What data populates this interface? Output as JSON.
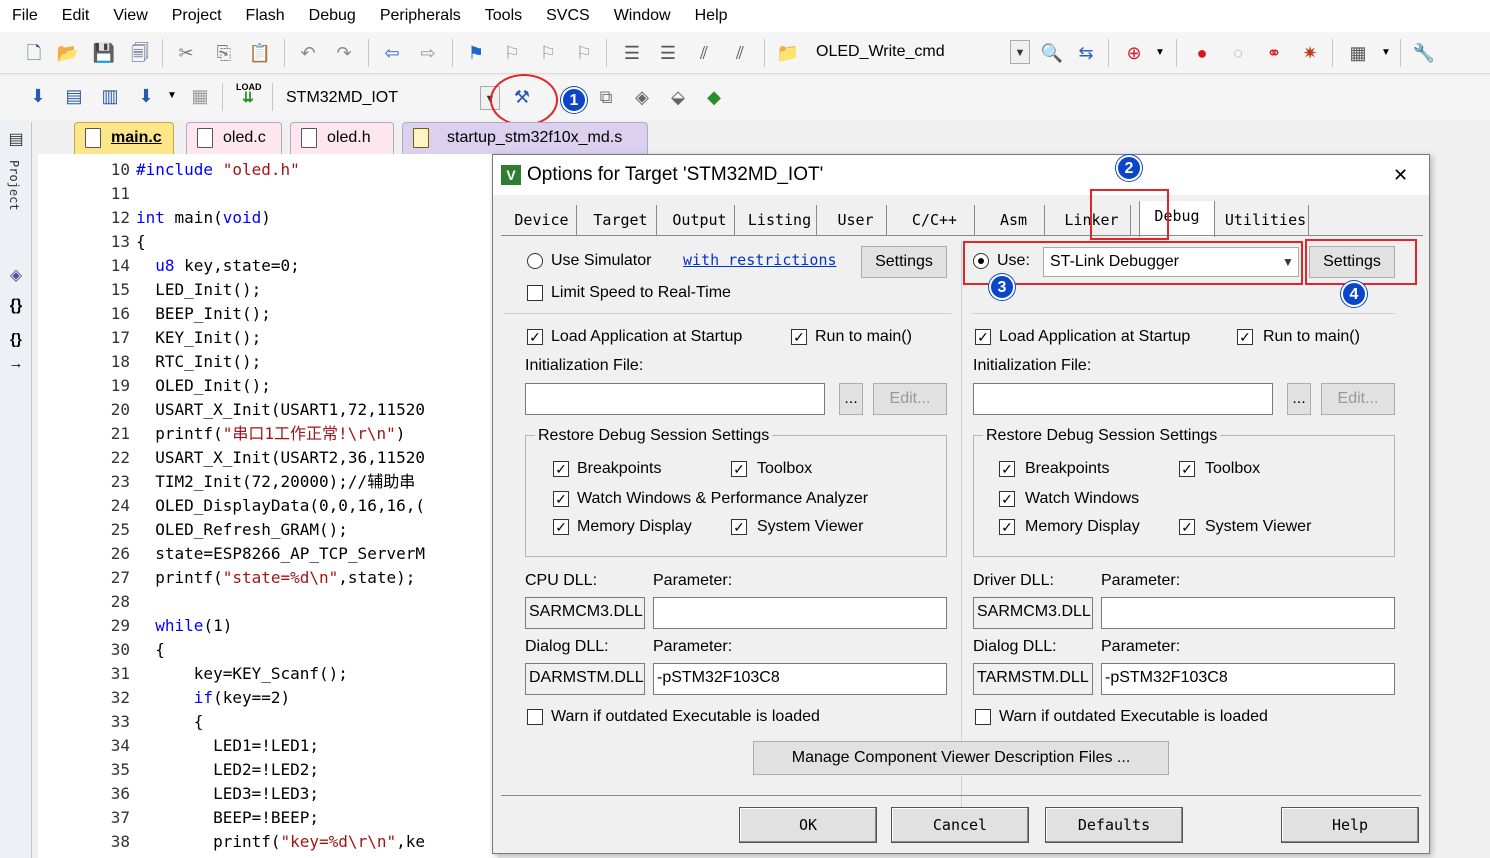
{
  "menubar": {
    "items": [
      "File",
      "Edit",
      "View",
      "Project",
      "Flash",
      "Debug",
      "Peripherals",
      "Tools",
      "SVCS",
      "Window",
      "Help"
    ]
  },
  "toolbar1": {
    "target_combo": "OLED_Write_cmd"
  },
  "toolbar2": {
    "target_select": "STM32MD_IOT",
    "load_label": "LOAD"
  },
  "file_tabs": [
    "main.c",
    "oled.c",
    "oled.h",
    "startup_stm32f10x_md.s"
  ],
  "side_panel": {
    "label": "Project"
  },
  "editor": {
    "lines": [
      {
        "n": "10",
        "t": "#include \"oled.h\""
      },
      {
        "n": "11",
        "t": ""
      },
      {
        "n": "12",
        "t": "int main(void)"
      },
      {
        "n": "13",
        "t": "{"
      },
      {
        "n": "14",
        "t": "  u8 key,state=0;"
      },
      {
        "n": "15",
        "t": "  LED_Init();"
      },
      {
        "n": "16",
        "t": "  BEEP_Init();"
      },
      {
        "n": "17",
        "t": "  KEY_Init();"
      },
      {
        "n": "18",
        "t": "  RTC_Init();"
      },
      {
        "n": "19",
        "t": "  OLED_Init();"
      },
      {
        "n": "20",
        "t": "  USART_X_Init(USART1,72,11520"
      },
      {
        "n": "21",
        "t": "  printf(\"串口1工作正常!\\r\\n\")"
      },
      {
        "n": "22",
        "t": "  USART_X_Init(USART2,36,11520"
      },
      {
        "n": "23",
        "t": "  TIM2_Init(72,20000);//辅助串"
      },
      {
        "n": "24",
        "t": "  OLED_DisplayData(0,0,16,16,("
      },
      {
        "n": "25",
        "t": "  OLED_Refresh_GRAM();"
      },
      {
        "n": "26",
        "t": "  state=ESP8266_AP_TCP_ServerM"
      },
      {
        "n": "27",
        "t": "  printf(\"state=%d\\n\",state);"
      },
      {
        "n": "28",
        "t": ""
      },
      {
        "n": "29",
        "t": "  while(1)"
      },
      {
        "n": "30",
        "t": "  {"
      },
      {
        "n": "31",
        "t": "      key=KEY_Scanf();"
      },
      {
        "n": "32",
        "t": "      if(key==2)"
      },
      {
        "n": "33",
        "t": "      {"
      },
      {
        "n": "34",
        "t": "        LED1=!LED1;"
      },
      {
        "n": "35",
        "t": "        LED2=!LED2;"
      },
      {
        "n": "36",
        "t": "        LED3=!LED3;"
      },
      {
        "n": "37",
        "t": "        BEEP=!BEEP;"
      },
      {
        "n": "38",
        "t": "        printf(\"key=%d\\r\\n\",ke"
      }
    ]
  },
  "dialog": {
    "title": "Options for Target 'STM32MD_IOT'",
    "tabs": [
      "Device",
      "Target",
      "Output",
      "Listing",
      "User",
      "C/C++",
      "Asm",
      "Linker",
      "Debug",
      "Utilities"
    ],
    "left": {
      "use_simulator": "Use Simulator",
      "with_restrictions": "with restrictions",
      "settings": "Settings",
      "limit_speed": "Limit Speed to Real-Time",
      "load_app": "Load Application at Startup",
      "run_to_main": "Run to main()",
      "init_file": "Initialization File:",
      "browse": "...",
      "edit": "Edit...",
      "restore_group": "Restore Debug Session Settings",
      "breakpoints": "Breakpoints",
      "toolbox": "Toolbox",
      "watch_windows": "Watch Windows & Performance Analyzer",
      "memory_display": "Memory Display",
      "system_viewer": "System Viewer",
      "dll_label": "CPU DLL:",
      "parameter": "Parameter:",
      "dll_value": "SARMCM3.DLL",
      "dll_param": "",
      "dialog_dll": "Dialog DLL:",
      "dialog_dll_value": "DARMSTM.DLL",
      "dialog_param": "-pSTM32F103C8",
      "warn": "Warn if outdated Executable is loaded"
    },
    "right": {
      "use": "Use:",
      "debugger": "ST-Link Debugger",
      "settings": "Settings",
      "load_app": "Load Application at Startup",
      "run_to_main": "Run to main()",
      "init_file": "Initialization File:",
      "browse": "...",
      "edit": "Edit...",
      "restore_group": "Restore Debug Session Settings",
      "breakpoints": "Breakpoints",
      "toolbox": "Toolbox",
      "watch_windows": "Watch Windows",
      "memory_display": "Memory Display",
      "system_viewer": "System Viewer",
      "dll_label": "Driver DLL:",
      "parameter": "Parameter:",
      "dll_value": "SARMCM3.DLL",
      "dll_param": "",
      "dialog_dll": "Dialog DLL:",
      "dialog_dll_value": "TARMSTM.DLL",
      "dialog_param": "-pSTM32F103C8",
      "warn": "Warn if outdated Executable is loaded"
    },
    "manage_button": "Manage Component Viewer Description Files ...",
    "ok": "OK",
    "cancel": "Cancel",
    "defaults": "Defaults",
    "help": "Help",
    "close_glyph": "✕",
    "check_glyph": "✓",
    "dropdown_glyph": "▼"
  },
  "annotations": [
    "1",
    "2",
    "3",
    "4"
  ],
  "colors": {
    "annotation_red": "#e0262b",
    "badge_blue": "#0b45c8",
    "keyword_blue": "#0000ff",
    "string_red": "#a31515",
    "tab_active": "#fde68a",
    "tab_pink": "#fde6ee",
    "tab_purple": "#dcd0ef"
  }
}
